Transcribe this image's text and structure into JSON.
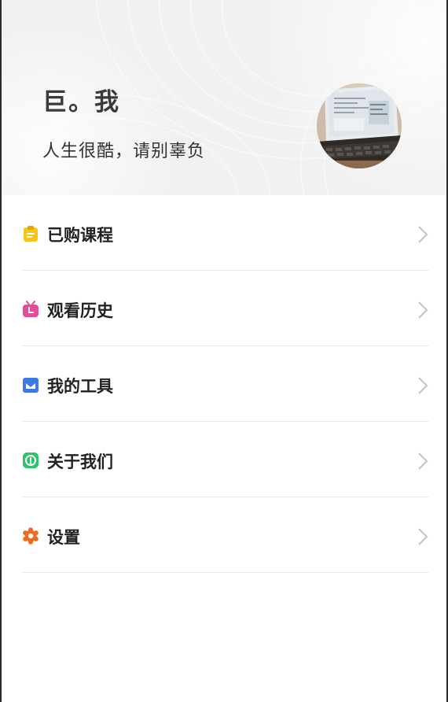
{
  "profile": {
    "nickname": "巨。我",
    "motto": "人生很酷，请别辜负"
  },
  "menu": {
    "items": [
      {
        "label": "已购课程",
        "icon": "clipboard-icon",
        "color": "#F5C518"
      },
      {
        "label": "观看历史",
        "icon": "tv-icon",
        "color": "#E84A9A"
      },
      {
        "label": "我的工具",
        "icon": "toolbox-icon",
        "color": "#3D78E6"
      },
      {
        "label": "关于我们",
        "icon": "info-icon",
        "color": "#2DC26B"
      },
      {
        "label": "设置",
        "icon": "gear-icon",
        "color": "#F26A1F"
      }
    ]
  }
}
